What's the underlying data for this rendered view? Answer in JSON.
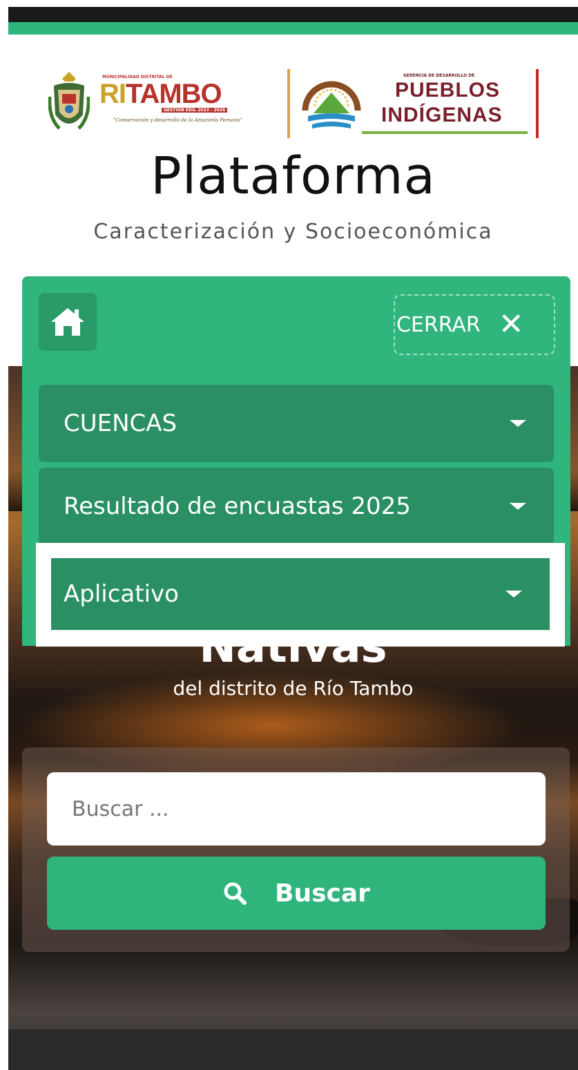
{
  "logos": {
    "municipality_small": "MUNICIPALIDAD DISTRITAL DE",
    "riotambo_ri": "RI",
    "riotambo_tambo": "TAMBO",
    "riotambo_term": "GESTIÓN EDIL 2023 - 2026",
    "riotambo_tagline": "\"Conservación y desarrollo de la Amazonía Peruana\"",
    "pueblos_small": "GERENCIA DE DESARROLLO DE",
    "pueblos_line1": "PUEBLOS",
    "pueblos_line2": "INDÍGENAS"
  },
  "header": {
    "title": "Plataforma",
    "subtitle": "Caracterización y Socioeconómica"
  },
  "menu": {
    "close_label": "CERRAR",
    "items": [
      {
        "label": "CUENCAS"
      },
      {
        "label": "Resultado de encuastas 2025"
      },
      {
        "label": "Aplicativo"
      }
    ]
  },
  "hero": {
    "title_partial": "Nativas",
    "subtitle": "del distrito de Río Tambo"
  },
  "search": {
    "placeholder": "Buscar ...",
    "button_label": "Buscar"
  },
  "colors": {
    "accent_green": "#30b57d",
    "menu_item_green": "#2a9064"
  }
}
